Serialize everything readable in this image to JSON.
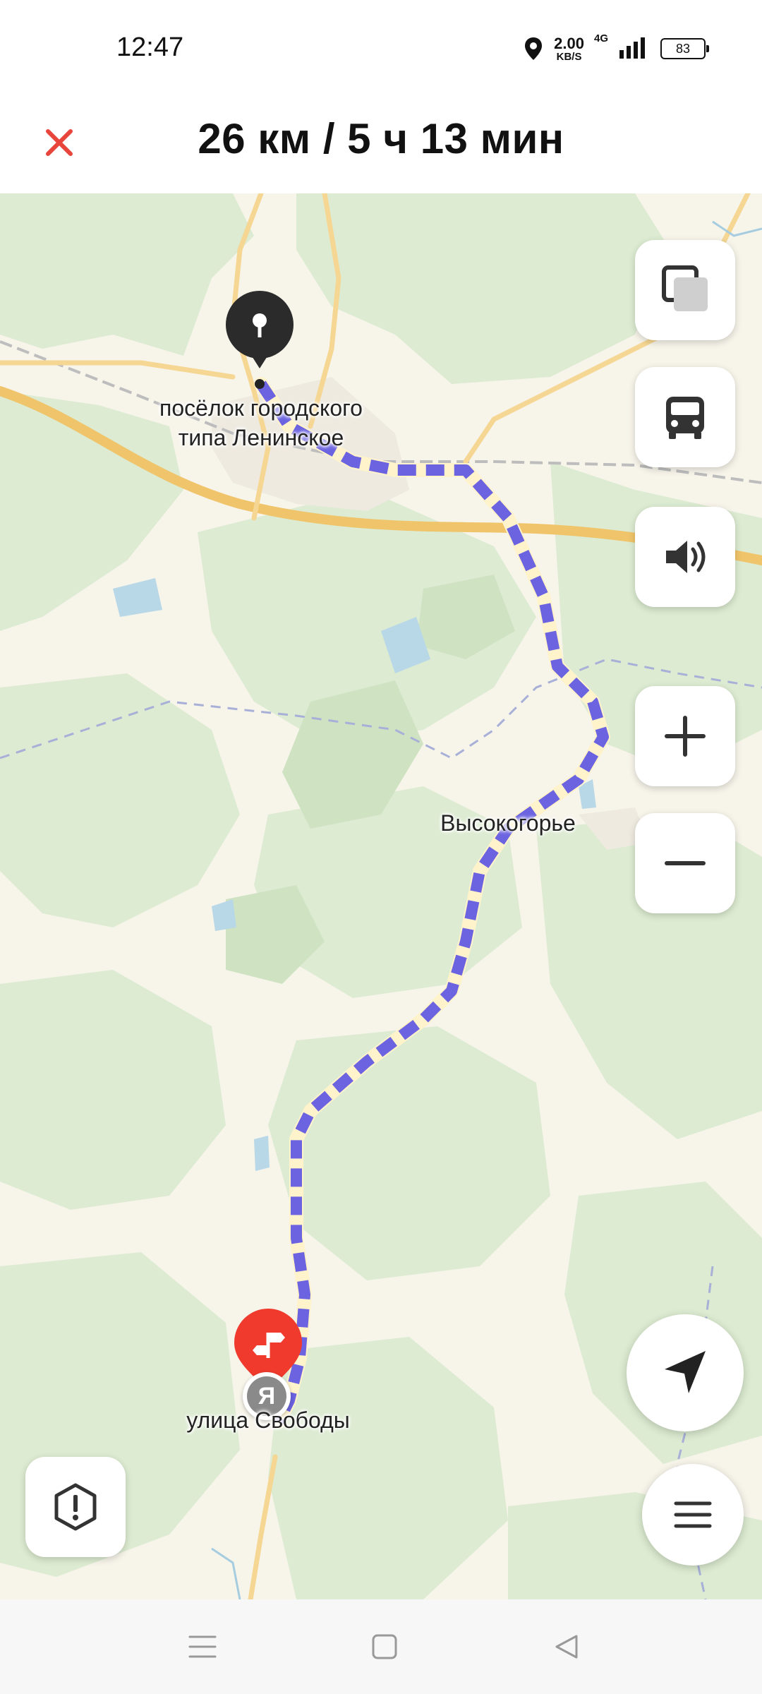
{
  "status_bar": {
    "time": "12:47",
    "net_speed_value": "2.00",
    "net_speed_unit": "KB/S",
    "network_type": "4G",
    "battery_level": "83"
  },
  "header": {
    "route_summary": "26 км / 5 ч 13 мин"
  },
  "map": {
    "labels": {
      "start_settlement": "посёлок городского\nтипа Ленинское",
      "village": "Высокогорье",
      "destination": "улица Свободы"
    },
    "yandex_badge": "Я",
    "route_color": "#6b63e0",
    "road_color": "#f5c36a",
    "forest_color": "#dbead0",
    "destination_pin_color": "#f03a2e",
    "start_pin_color": "#2b2b2b"
  },
  "controls": {
    "layers": "layers-icon",
    "transport": "bus-icon",
    "sound": "speaker-icon",
    "zoom_in": "plus-icon",
    "zoom_out": "minus-icon",
    "locate": "navigation-arrow-icon",
    "menu": "menu-icon",
    "report": "alert-icon"
  },
  "nav_bar": {
    "menu": "menu-lines-icon",
    "home": "square-icon",
    "back": "triangle-back-icon"
  }
}
